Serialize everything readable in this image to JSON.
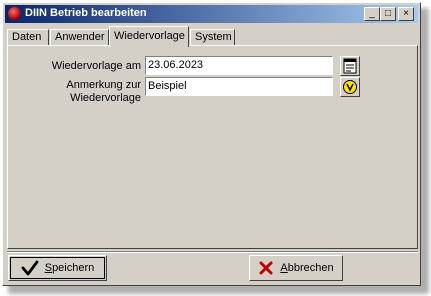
{
  "window": {
    "title": "DIIN Betrieb bearbeiten",
    "controls": {
      "minimize": "_",
      "maximize": "□",
      "close": "×"
    }
  },
  "tabs": [
    {
      "label": "Daten"
    },
    {
      "label": "Anwender"
    },
    {
      "label": "Wiedervorlage"
    },
    {
      "label": "System"
    }
  ],
  "active_tab": "Wiedervorlage",
  "form": {
    "date_label": "Wiedervorlage am",
    "date_value": "23.06.2023",
    "note_label_line1": "Anmerkung zur",
    "note_label_line2": "Wiedervorlage",
    "note_value": "Beispiel"
  },
  "buttons": {
    "save": {
      "label_first": "S",
      "label_rest": "peichern",
      "icon": "checkmark-icon"
    },
    "cancel": {
      "label_first": "A",
      "label_rest": "bbrechen",
      "icon": "red-x-icon"
    }
  },
  "colors": {
    "titlebar_start": "#0a246a",
    "titlebar_end": "#a6caf0",
    "face": "#d4d0c8"
  }
}
